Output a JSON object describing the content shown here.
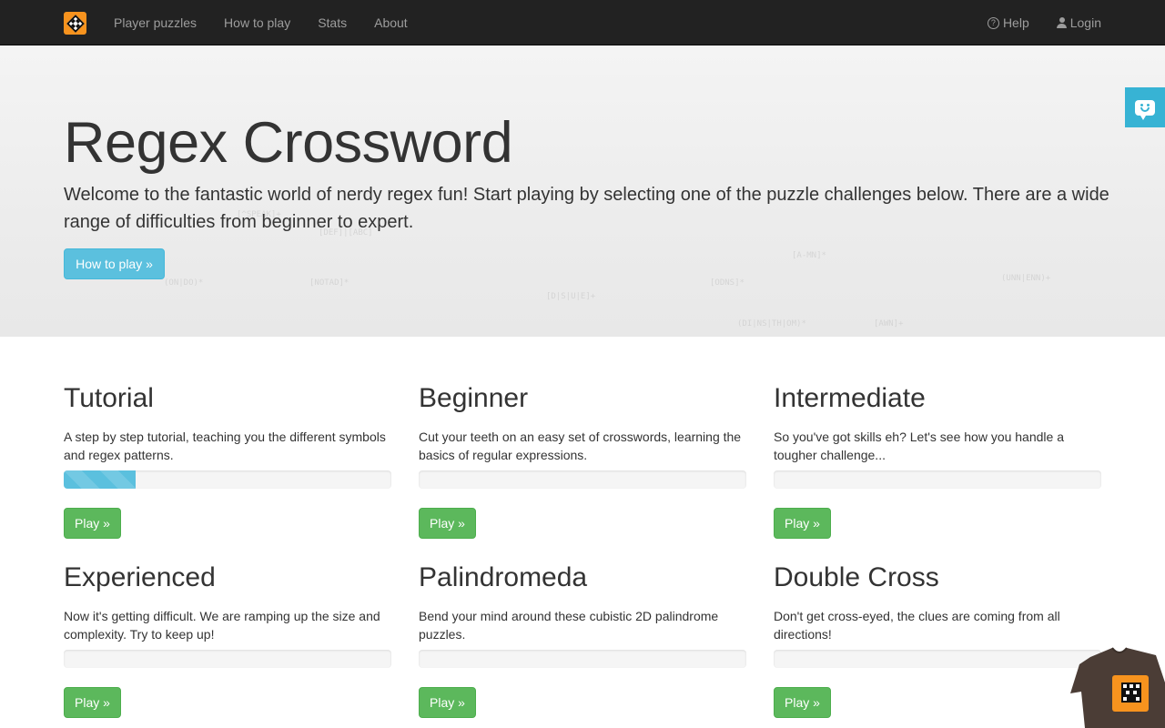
{
  "nav": {
    "logo_alt": "Regex Crossword logo",
    "left_items": [
      {
        "label": "Player puzzles"
      },
      {
        "label": "How to play"
      },
      {
        "label": "Stats"
      },
      {
        "label": "About"
      }
    ],
    "help_label": "Help",
    "login_label": "Login"
  },
  "hero": {
    "title": "Regex Crossword",
    "lead": "Welcome to the fantastic world of nerdy regex fun! Start playing by selecting one of the puzzle challenges below. There are a wide range of difficulties from beginner to expert.",
    "button_label": "How to play »",
    "background_snippets": [
      "[^SPEAK]+",
      "[DEF]|[ABC]",
      "(ON|DO)*",
      "[NOTAD]*",
      "[D|S|U|E]+",
      "(DI|NS|TH|OM)*",
      "[AWN]+",
      "[ODNS]*",
      "(UNN|ENN)+",
      "[A-MN]*"
    ]
  },
  "feedback": {
    "icon": "smiley-chat-icon"
  },
  "colors": {
    "navbar": "#222222",
    "info": "#5bc0de",
    "success": "#5cb85c",
    "feedback": "#37b3d4"
  },
  "puzzles": [
    {
      "title": "Tutorial",
      "description": "A step by step tutorial, teaching you the different symbols and regex patterns.",
      "progress_percent": 22,
      "button_label": "Play »"
    },
    {
      "title": "Beginner",
      "description": "Cut your teeth on an easy set of crosswords, learning the basics of regular expressions.",
      "progress_percent": 0,
      "button_label": "Play »"
    },
    {
      "title": "Intermediate",
      "description": "So you've got skills eh? Let's see how you handle a tougher challenge...",
      "progress_percent": 0,
      "button_label": "Play »"
    },
    {
      "title": "Experienced",
      "description": "Now it's getting difficult. We are ramping up the size and complexity. Try to keep up!",
      "progress_percent": 0,
      "button_label": "Play »"
    },
    {
      "title": "Palindromeda",
      "description": "Bend your mind around these cubistic 2D palindrome puzzles.",
      "progress_percent": 0,
      "button_label": "Play »"
    },
    {
      "title": "Double Cross",
      "description": "Don't get cross-eyed, the clues are coming from all directions!",
      "progress_percent": 0,
      "button_label": "Play »"
    }
  ]
}
